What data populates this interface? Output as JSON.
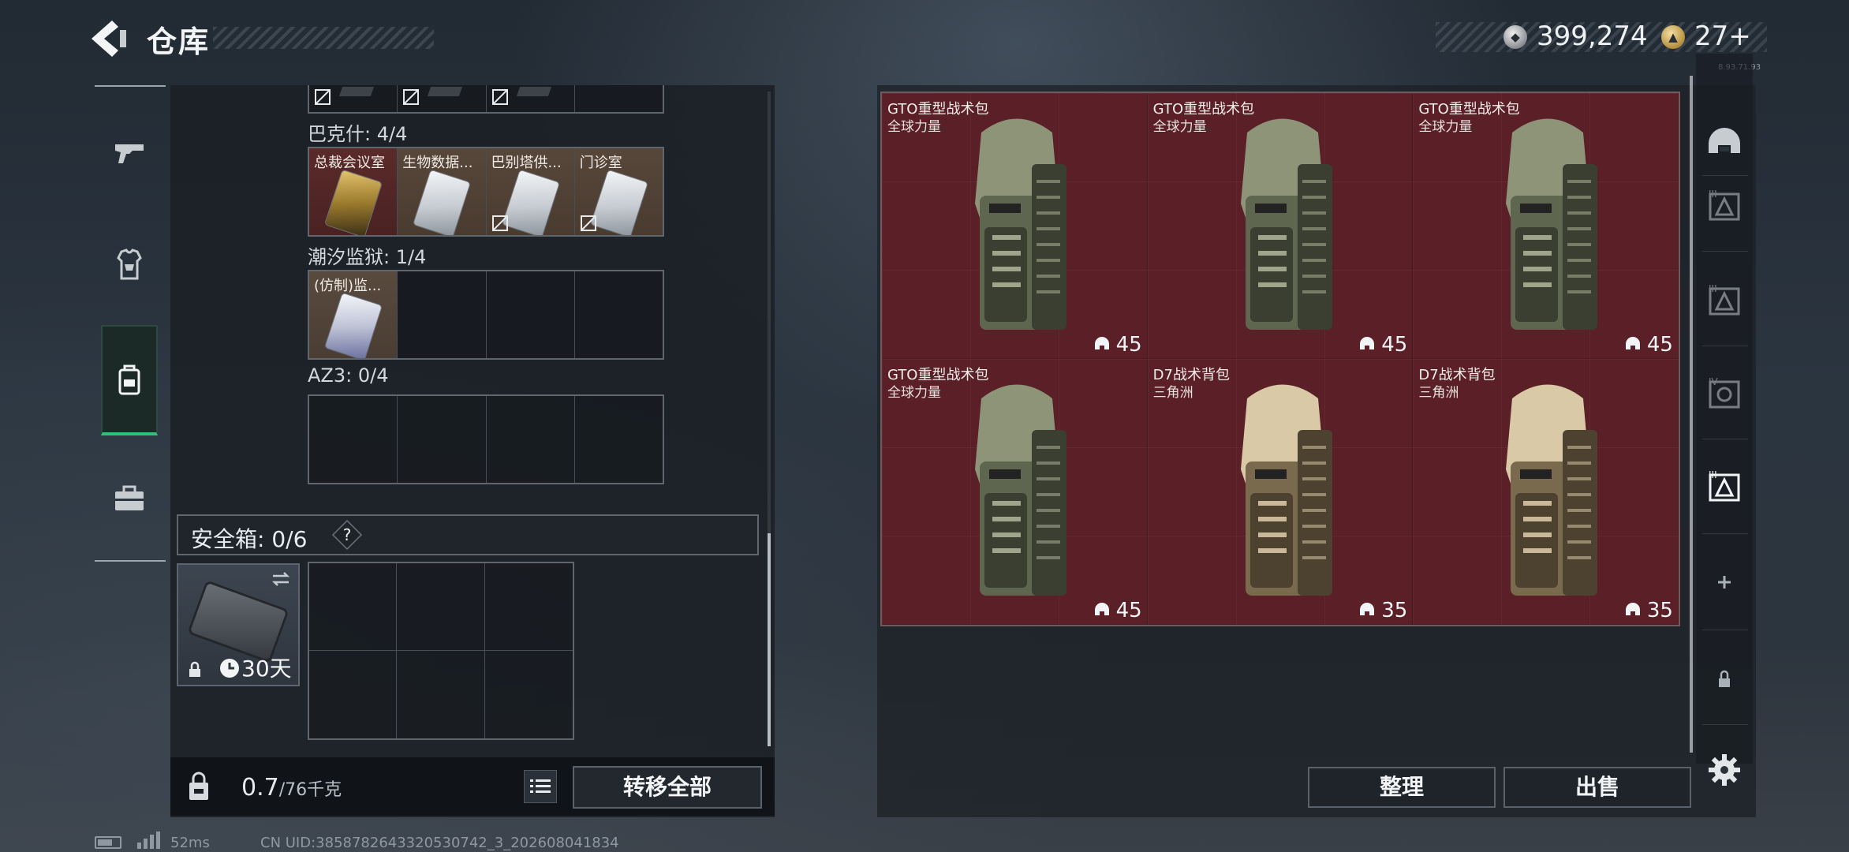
{
  "header": {
    "title": "仓库",
    "currency_silver": "399,274",
    "currency_gold": "27+",
    "version_tag": "8.93.71.93"
  },
  "left_tabs": [
    {
      "name": "weapons",
      "icon": "pistol-icon"
    },
    {
      "name": "gear",
      "icon": "armor-icon"
    },
    {
      "name": "backpack",
      "icon": "backpack-icon",
      "active": true
    },
    {
      "name": "keys",
      "icon": "briefcase-icon"
    }
  ],
  "key_groups": [
    {
      "label": "巴克什: 4/4",
      "cards": [
        {
          "name": "总裁会议室",
          "style": "gold",
          "bg": "red",
          "linked": true
        },
        {
          "name": "生物数据...",
          "style": "silver",
          "bg": "brown",
          "linked": true
        },
        {
          "name": "巴别塔供...",
          "style": "silver",
          "bg": "brown",
          "linked": false
        },
        {
          "name": "门诊室",
          "style": "silver",
          "bg": "brown",
          "linked": false
        }
      ]
    },
    {
      "label": "潮汐监狱: 1/4",
      "cards": [
        {
          "name": "(仿制)监...",
          "style": "holo",
          "bg": "purple",
          "linked": true
        }
      ]
    },
    {
      "label": "AZ3: 0/4",
      "cards": []
    }
  ],
  "safe_box": {
    "label": "安全箱: 0/6",
    "help": "?",
    "duration": "30天"
  },
  "weight": {
    "current": "0.7",
    "max_unit": "/76千克"
  },
  "buttons": {
    "transfer_all": "转移全部",
    "sort": "整理",
    "sell": "出售"
  },
  "items": [
    {
      "name": "GTO重型战术包",
      "brand": "全球力量",
      "count": "45",
      "color": "olive"
    },
    {
      "name": "GTO重型战术包",
      "brand": "全球力量",
      "count": "45",
      "color": "olive"
    },
    {
      "name": "GTO重型战术包",
      "brand": "全球力量",
      "count": "45",
      "color": "olive"
    },
    {
      "name": "GTO重型战术包",
      "brand": "全球力量",
      "count": "45",
      "color": "olive"
    },
    {
      "name": "D7战术背包",
      "brand": "三角洲",
      "count": "35",
      "color": "tan"
    },
    {
      "name": "D7战术背包",
      "brand": "三角洲",
      "count": "35",
      "color": "tan"
    }
  ],
  "right_tabs": [
    {
      "name": "helmet-slot",
      "icon": "helmet-icon"
    },
    {
      "name": "armor-slot-3a",
      "icon": "armor-tier-3-icon"
    },
    {
      "name": "armor-slot-3b",
      "icon": "armor-tier-3-icon"
    },
    {
      "name": "armor-slot-4",
      "icon": "armor-tier-4-icon"
    },
    {
      "name": "armor-slot-3-active",
      "icon": "armor-tier-3-icon"
    },
    {
      "name": "add-slot",
      "icon": "plus-icon"
    },
    {
      "name": "locked-slot",
      "icon": "lock-icon"
    },
    {
      "name": "settings",
      "icon": "gear-icon"
    }
  ],
  "status": {
    "ping": "52ms",
    "uid": "CN UID:3858782643320530742_3_202608041834"
  }
}
